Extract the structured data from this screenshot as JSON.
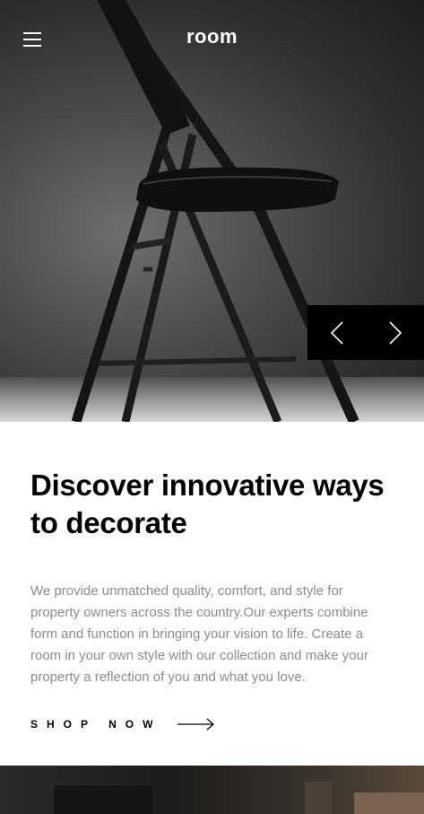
{
  "header": {
    "logo": "room"
  },
  "hero": {
    "image_alt": "Black folding chair"
  },
  "slider": {
    "prev_icon": "chevron-left-icon",
    "next_icon": "chevron-right-icon"
  },
  "main": {
    "headline": "Discover innovative ways to decorate",
    "description": "We provide unmatched quality, comfort, and style for property owners across the country.Our experts combine form and function in bringing your vision to life. Create a room in your own style with our collection and make your property a reflection of you and what you love.",
    "cta_label": "SHOP NOW",
    "cta_icon": "arrow-right-icon"
  },
  "colors": {
    "text_dark": "#000000",
    "text_muted": "#8c8c8c",
    "accent": "#000000"
  }
}
